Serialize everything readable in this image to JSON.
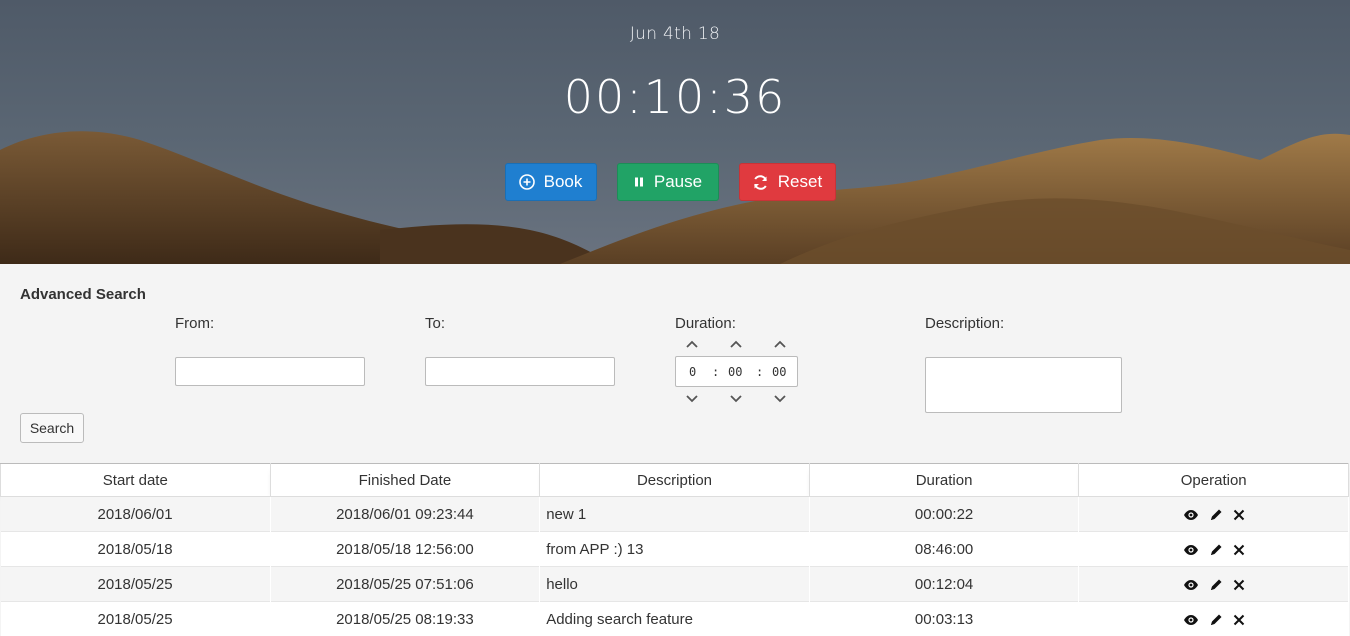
{
  "header": {
    "date": "Jun 4th 18",
    "timer": "00:10:36",
    "buttons": {
      "book": "Book",
      "pause": "Pause",
      "reset": "Reset"
    }
  },
  "search": {
    "title": "Advanced Search",
    "from_label": "From:",
    "to_label": "To:",
    "duration_label": "Duration:",
    "description_label": "Description:",
    "from_value": "",
    "to_value": "",
    "description_value": "",
    "duration": {
      "hours": "0",
      "minutes": "00",
      "seconds": "00",
      "sep1": ":",
      "sep2": ":"
    },
    "search_button": "Search"
  },
  "table": {
    "headers": [
      "Start date",
      "Finished Date",
      "Description",
      "Duration",
      "Operation"
    ],
    "rows": [
      {
        "start": "2018/06/01",
        "finished": "2018/06/01 09:23:44",
        "description": "new 1",
        "duration": "00:00:22"
      },
      {
        "start": "2018/05/18",
        "finished": "2018/05/18 12:56:00",
        "description": "from APP :) 13",
        "duration": "08:46:00"
      },
      {
        "start": "2018/05/25",
        "finished": "2018/05/25 07:51:06",
        "description": "hello",
        "duration": "00:12:04"
      },
      {
        "start": "2018/05/25",
        "finished": "2018/05/25 08:19:33",
        "description": "Adding search feature",
        "duration": "00:03:13"
      }
    ],
    "operation_icons": [
      "eye-icon",
      "pencil-icon",
      "close-icon"
    ]
  },
  "colors": {
    "book": "#1f7fd0",
    "pause": "#21a366",
    "reset": "#e03a3f"
  }
}
